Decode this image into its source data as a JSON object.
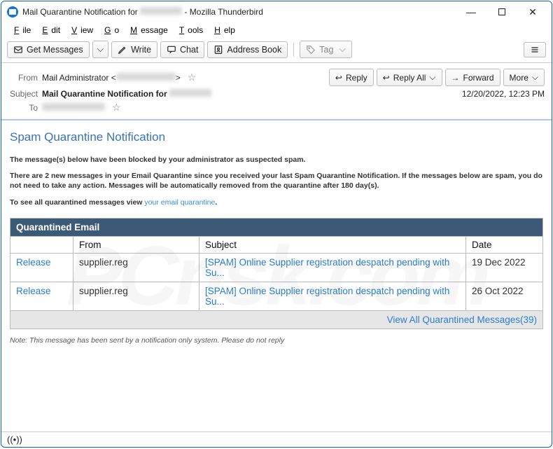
{
  "window": {
    "title": "Mail Quarantine Notification for",
    "app": " - Mozilla Thunderbird"
  },
  "menubar": [
    "File",
    "Edit",
    "View",
    "Go",
    "Message",
    "Tools",
    "Help"
  ],
  "toolbar": {
    "get": "Get Messages",
    "write": "Write",
    "chat": "Chat",
    "addressbook": "Address Book",
    "tag": "Tag"
  },
  "headers": {
    "from_label": "From",
    "from_name": "Mail Administrator <",
    "from_suffix": ">",
    "subject_label": "Subject",
    "subject": "Mail Quarantine Notification for",
    "to_label": "To",
    "datetime": "12/20/2022, 12:23 PM",
    "reply": "Reply",
    "replyall": "Reply All",
    "forward": "Forward",
    "more": "More"
  },
  "body": {
    "title": "Spam Quarantine Notification",
    "intro": "The message(s) below have been blocked by your administrator as suspected spam.",
    "para2": "There are 2 new messages in your Email Quarantine since you received your last Spam Quarantine Notification. If the messages below are spam, you do not need to take any action. Messages will be automatically removed from the quarantine after 180 day(s).",
    "para3a": "To see all quarantined messages view  ",
    "para3link": "your email quarantine",
    "para3b": ".",
    "note": "Note: This message has been sent by a notification only system. Please do not reply"
  },
  "table": {
    "header": "Quarantined Email",
    "cols": {
      "from": "From",
      "subject": "Subject",
      "date": "Date"
    },
    "release": "Release",
    "rows": [
      {
        "from": "supplier.reg",
        "subject": "[SPAM] Online Supplier registration despatch pending with Su...",
        "date": "19 Dec 2022"
      },
      {
        "from": "supplier.reg",
        "subject": "[SPAM] Online Supplier registration despatch pending with Su...",
        "date": "26 Oct 2022"
      }
    ],
    "viewall": "View All Quarantined Messages(39)"
  }
}
